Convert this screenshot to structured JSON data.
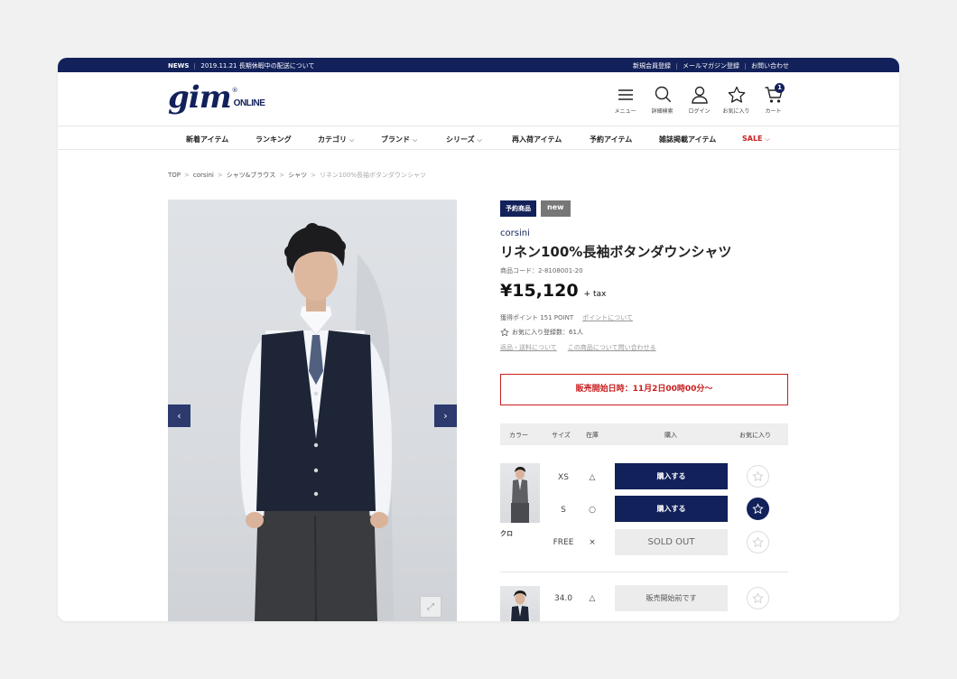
{
  "news": {
    "tag": "NEWS",
    "text": "2019.11.21  長期休暇中の配送について",
    "links": [
      "新規会員登録",
      "メールマガジン登録",
      "お問い合わせ"
    ]
  },
  "logo": {
    "main": "gim",
    "reg": "®",
    "sub": "ONLINE"
  },
  "header_icons": [
    {
      "icon": "menu-icon",
      "label": "メニュー"
    },
    {
      "icon": "search-icon",
      "label": "詳細検索"
    },
    {
      "icon": "user-icon",
      "label": "ログイン"
    },
    {
      "icon": "star-icon",
      "label": "お気に入り"
    },
    {
      "icon": "cart-icon",
      "label": "カート",
      "badge": "1"
    }
  ],
  "nav": [
    {
      "label": "新着アイテム"
    },
    {
      "label": "ランキング"
    },
    {
      "label": "カテゴリ",
      "chevron": "⌵"
    },
    {
      "label": "ブランド",
      "chevron": "⌵"
    },
    {
      "label": "シリーズ",
      "chevron": "⌵"
    },
    {
      "label": "再入荷アイテム"
    },
    {
      "label": "予約アイテム"
    },
    {
      "label": "雑誌掲載アイテム"
    },
    {
      "label": "SALE",
      "chevron": "⌵"
    }
  ],
  "breadcrumb": [
    "TOP",
    "corsini",
    "シャツ&ブラウス",
    "シャツ",
    "リネン100%長袖ボタンダウンシャツ"
  ],
  "breadcrumb_sep": ">",
  "gallery": {
    "prev": "‹",
    "next": "›",
    "expand": "⤢"
  },
  "product": {
    "badge_preorder": "予約商品",
    "badge_new": "new",
    "brand": "corsini",
    "title": "リネン100%長袖ボタンダウンシャツ",
    "code": "商品コード：2-8108001-20",
    "price": "¥15,120",
    "tax": "+ tax",
    "points": "獲得ポイント 151 POINT",
    "points_link": "ポイントについて",
    "favorites": "お気に入り登録数：61人",
    "link_returns": "返品・送料について",
    "link_inquiry": "この商品について問い合わせる",
    "sale_start": "販売開始日時：11月2日00時00分～"
  },
  "table": {
    "headers": {
      "color": "カラー",
      "size": "サイズ",
      "stock": "在庫",
      "buy": "購入",
      "fav": "お気に入り"
    },
    "group1": {
      "color_name": "クロ",
      "rows": [
        {
          "size": "XS",
          "stock": "△",
          "action": "購入する"
        },
        {
          "size": "S",
          "stock": "○",
          "action": "購入する"
        },
        {
          "size": "FREE",
          "stock": "×",
          "action": "SOLD OUT"
        }
      ]
    },
    "group2": {
      "rows": [
        {
          "size": "34.0",
          "stock": "△",
          "action": "販売開始前です"
        }
      ]
    }
  },
  "colors": {
    "navy": "#12215a",
    "red": "#c81e1e"
  }
}
